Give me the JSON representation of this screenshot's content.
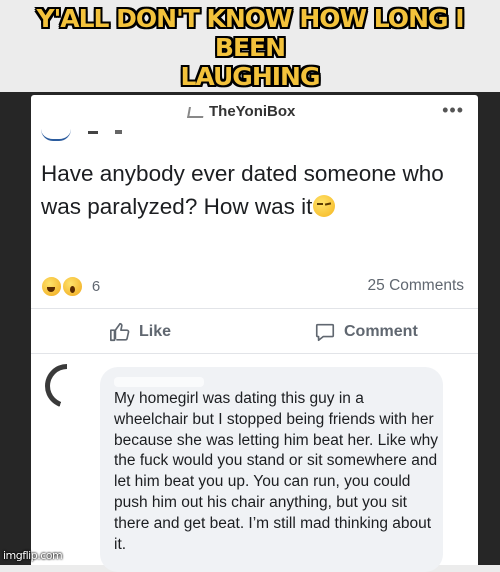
{
  "meme": {
    "caption_line1": "Y'ALL DON'T KNOW HOW LONG I BEEN",
    "caption_line2": "LAUGHING",
    "watermark": "imgflip.com"
  },
  "post": {
    "page_name": "TheYoniBox",
    "more_icon": "more-icon",
    "question": "Have anybody ever dated someone who was paralyzed? How was it",
    "reaction_icons": [
      "laughing-face",
      "wow-face"
    ],
    "reaction_count": "6",
    "comments_count": "25 Comments",
    "like_label": "Like",
    "comment_label": "Comment"
  },
  "comment": {
    "text": "My homegirl was dating this guy in a wheelchair but I stopped being friends with her because she was letting him beat her. Like why the fuck would you stand or sit somewhere and let him beat you up. You can run, you could push him out his chair anything, but you sit there and get beat. I’m still mad thinking about it."
  },
  "colors": {
    "caption_fill": "#f3c23b",
    "card_bg": "#ffffff",
    "bubble_bg": "#f0f2f5",
    "muted_text": "#606770"
  }
}
